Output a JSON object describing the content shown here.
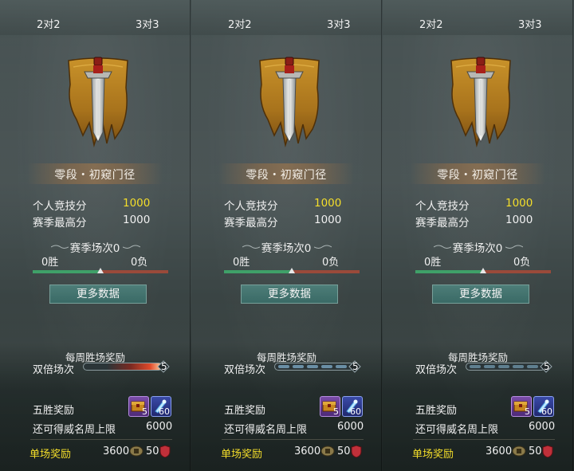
{
  "panels": [
    {
      "tabs": [
        "2对2",
        "3对3"
      ],
      "rank_name": "零段・初窥门径",
      "personal_score_label": "个人竞技分",
      "personal_score_value": "1000",
      "season_high_label": "赛季最高分",
      "season_high_value": "1000",
      "season_matches": "赛季场次0",
      "wins": "0胜",
      "losses": "0负",
      "win_ratio": 0.5,
      "more_data_label": "更多数据",
      "weekly_reward_title": "每周胜场奖励",
      "double_label": "双倍场次",
      "double_count": "5",
      "double_bar_style": "red-glow",
      "five_win_label": "五胜奖励",
      "reward_items": [
        {
          "icon": "chest-icon",
          "qty": "5"
        },
        {
          "icon": "scroll-icon",
          "qty": "60"
        }
      ],
      "prestige_limit_label": "还可得威名周上限",
      "prestige_limit_value": "6000",
      "match_reward_label": "单场奖励",
      "match_reward_coin": "3600",
      "match_reward_badge": "50"
    },
    {
      "tabs": [
        "2对2",
        "3对3"
      ],
      "rank_name": "零段・初窥门径",
      "personal_score_label": "个人竞技分",
      "personal_score_value": "1000",
      "season_high_label": "赛季最高分",
      "season_high_value": "1000",
      "season_matches": "赛季场次0",
      "wins": "0胜",
      "losses": "0负",
      "win_ratio": 0.5,
      "more_data_label": "更多数据",
      "weekly_reward_title": "每周胜场奖励",
      "double_label": "双倍场次",
      "double_count": "5",
      "double_bar_style": "blue-segments",
      "five_win_label": "五胜奖励",
      "reward_items": [
        {
          "icon": "chest-icon",
          "qty": "5"
        },
        {
          "icon": "scroll-icon",
          "qty": "60"
        }
      ],
      "prestige_limit_label": "还可得威名周上限",
      "prestige_limit_value": "6000",
      "match_reward_label": "单场奖励",
      "match_reward_coin": "3600",
      "match_reward_badge": "50"
    },
    {
      "tabs": [
        "2对2",
        "3对3"
      ],
      "rank_name": "零段・初窥门径",
      "personal_score_label": "个人竞技分",
      "personal_score_value": "1000",
      "season_high_label": "赛季最高分",
      "season_high_value": "1000",
      "season_matches": "赛季场次0",
      "wins": "0胜",
      "losses": "0负",
      "win_ratio": 0.5,
      "more_data_label": "更多数据",
      "weekly_reward_title": "每周胜场奖励",
      "double_label": "双倍场次",
      "double_count": "5",
      "double_bar_style": "dim-segments",
      "five_win_label": "五胜奖励",
      "reward_items": [
        {
          "icon": "chest-icon",
          "qty": "5"
        },
        {
          "icon": "scroll-icon",
          "qty": "60"
        }
      ],
      "prestige_limit_label": "还可得威名周上限",
      "prestige_limit_value": "6000",
      "match_reward_label": "单场奖励",
      "match_reward_coin": "3600",
      "match_reward_badge": "50"
    }
  ],
  "colors": {
    "score_yellow": "#f4de2a",
    "button_teal": "#3f716c",
    "win_green": "#3fa068",
    "loss_red": "#9a4a3a"
  }
}
